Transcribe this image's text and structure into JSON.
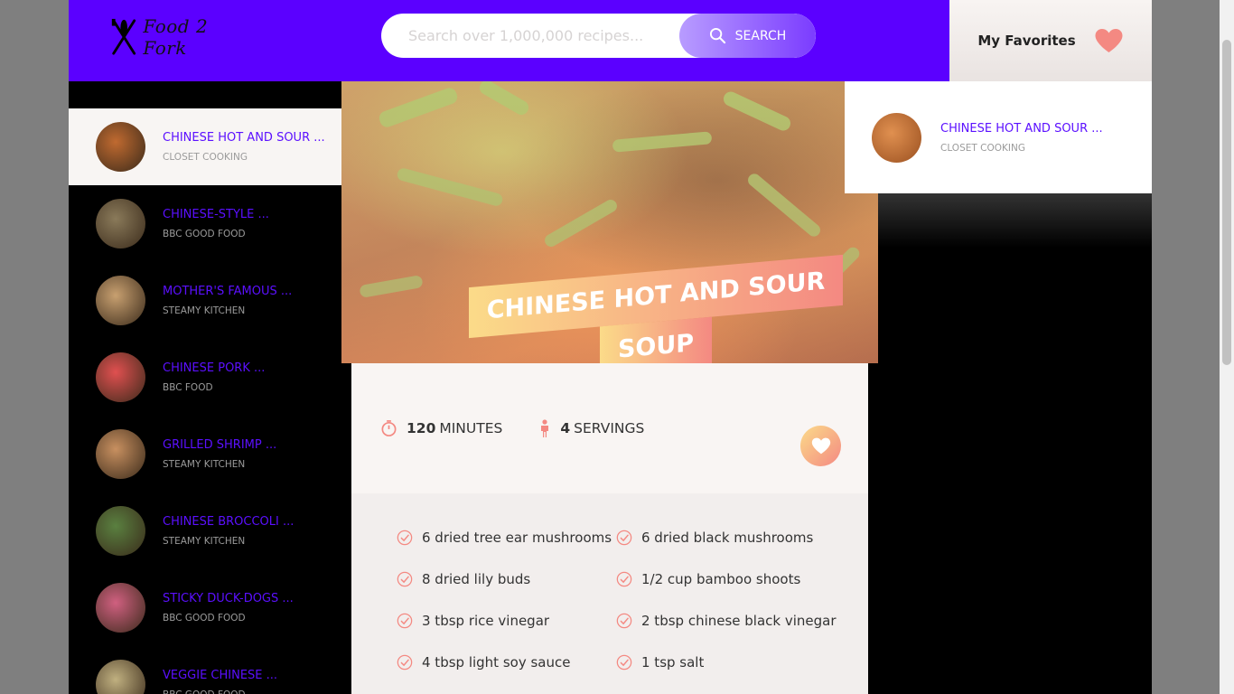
{
  "header": {
    "logo_text": "Food 2 Fork",
    "search_placeholder": "Search over 1,000,000 recipes...",
    "search_button": "SEARCH",
    "favorites_label": "My Favorites"
  },
  "sidebar": {
    "items": [
      {
        "title": "CHINESE HOT AND SOUR ...",
        "publisher": "CLOSET COOKING",
        "thumb_color": "#c06a30",
        "active": true
      },
      {
        "title": "CHINESE-STYLE ...",
        "publisher": "BBC GOOD FOOD",
        "thumb_color": "#8a7a5a"
      },
      {
        "title": "MOTHER'S FAMOUS ...",
        "publisher": "STEAMY KITCHEN",
        "thumb_color": "#c8a070"
      },
      {
        "title": "CHINESE PORK ...",
        "publisher": "BBC FOOD",
        "thumb_color": "#e05050"
      },
      {
        "title": "GRILLED SHRIMP ...",
        "publisher": "STEAMY KITCHEN",
        "thumb_color": "#c89060"
      },
      {
        "title": "CHINESE BROCCOLI ...",
        "publisher": "STEAMY KITCHEN",
        "thumb_color": "#5a8040"
      },
      {
        "title": "STICKY DUCK-DOGS ...",
        "publisher": "BBC GOOD FOOD",
        "thumb_color": "#d06080"
      },
      {
        "title": "VEGGIE CHINESE ...",
        "publisher": "BBC GOOD FOOD",
        "thumb_color": "#c0b080"
      }
    ]
  },
  "recipe": {
    "title_line1": "CHINESE HOT AND SOUR",
    "title_line2": "SOUP",
    "minutes_value": "120",
    "minutes_label": "MINUTES",
    "servings_value": "4",
    "servings_label": "SERVINGS",
    "ingredients": [
      "6 dried tree ear mushrooms",
      "6 dried black mushrooms",
      "8 dried lily buds",
      "1/2 cup bamboo shoots",
      "3 tbsp rice vinegar",
      "2 tbsp chinese black vinegar",
      "4 tbsp light soy sauce",
      "1 tsp salt"
    ]
  },
  "favorites_panel": {
    "title": "CHINESE HOT AND SOUR ...",
    "publisher": "CLOSET COOKING"
  },
  "colors": {
    "header_bg": "#5b00ff",
    "accent": "#5b10ff",
    "gradient_start": "#fbdb89",
    "gradient_end": "#f48982"
  }
}
